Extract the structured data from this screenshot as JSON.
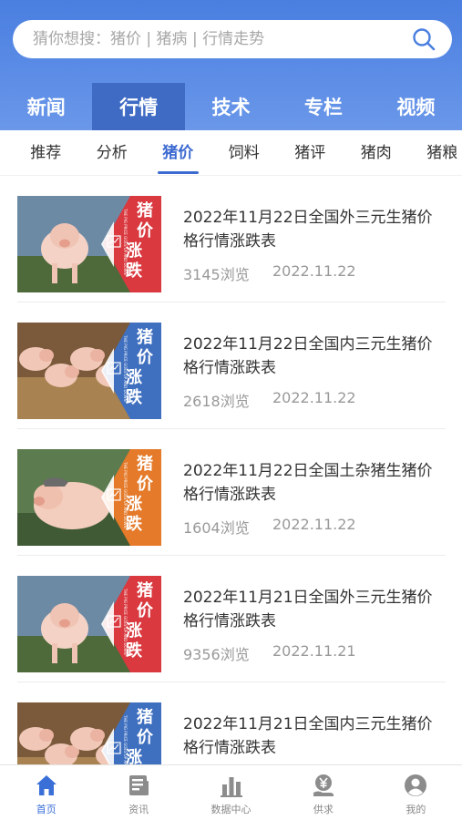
{
  "search": {
    "placeholder": "猜你想搜：猪价 | 猪病 | 行情走势"
  },
  "main_tabs": [
    "新闻",
    "行情",
    "技术",
    "专栏",
    "视频"
  ],
  "active_main_tab": "行情",
  "sub_tabs": [
    "推荐",
    "分析",
    "猪价",
    "饲料",
    "猪评",
    "猪肉",
    "猪粮"
  ],
  "active_sub_tab": "猪价",
  "thumbnail": {
    "badge_text": "猪价涨跌",
    "badge_subtext": "THE PIG PRICE GOES UP AND DOWN"
  },
  "articles": [
    {
      "title": "2022年11月22日全国外三元生猪价格行情涨跌表",
      "views": "3145浏览",
      "date": "2022.11.22",
      "badge_color": "#d9393f",
      "scene": "single-pig"
    },
    {
      "title": "2022年11月22日全国内三元生猪价格行情涨跌表",
      "views": "2618浏览",
      "date": "2022.11.22",
      "badge_color": "#3f6fbf",
      "scene": "piglets"
    },
    {
      "title": "2022年11月22日全国土杂猪生猪价格行情涨跌表",
      "views": "1604浏览",
      "date": "2022.11.22",
      "badge_color": "#e47a2a",
      "scene": "pig-with-hat"
    },
    {
      "title": "2022年11月21日全国外三元生猪价格行情涨跌表",
      "views": "9356浏览",
      "date": "2022.11.21",
      "badge_color": "#d9393f",
      "scene": "single-pig"
    },
    {
      "title": "2022年11月21日全国内三元生猪价格行情涨跌表",
      "views": "",
      "date": "",
      "badge_color": "#3f6fbf",
      "scene": "piglets"
    }
  ],
  "bottom_nav": [
    {
      "label": "首页",
      "icon": "home-icon",
      "active": true
    },
    {
      "label": "资讯",
      "icon": "news-icon",
      "active": false
    },
    {
      "label": "数据中心",
      "icon": "data-chart-icon",
      "active": false
    },
    {
      "label": "供求",
      "icon": "yuan-supply-icon",
      "active": false
    },
    {
      "label": "我的",
      "icon": "user-icon",
      "active": false
    }
  ],
  "colors": {
    "primary": "#3d6ad1",
    "header_gradient_top": "#4a7fe0",
    "active_tab_bg": "#3f6bc4"
  }
}
